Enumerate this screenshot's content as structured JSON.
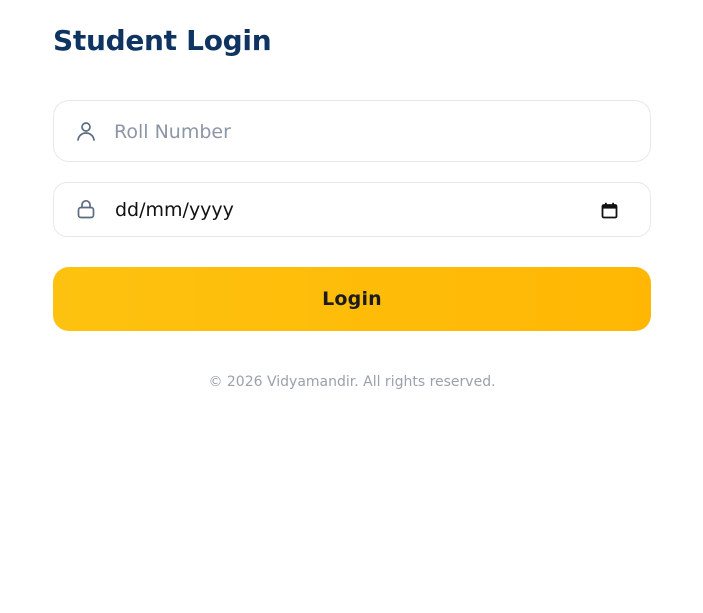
{
  "title": "Student Login",
  "roll_field": {
    "placeholder": "Roll Number",
    "value": "",
    "icon": "user-icon"
  },
  "date_field": {
    "display_value": "dd/mm/yyyy",
    "icon": "lock-icon",
    "trailing_icon": "calendar-icon"
  },
  "login_button": {
    "label": "Login"
  },
  "footer": {
    "text": "© 2026 Vidyamandir. All rights reserved."
  },
  "colors": {
    "title": "#0f3462",
    "button_start": "#fdc20f",
    "button_end": "#ffb703",
    "placeholder": "#8c96a6",
    "footer": "#9aa1ad",
    "border": "#e6e8ec",
    "icon": "#5a6b82"
  }
}
